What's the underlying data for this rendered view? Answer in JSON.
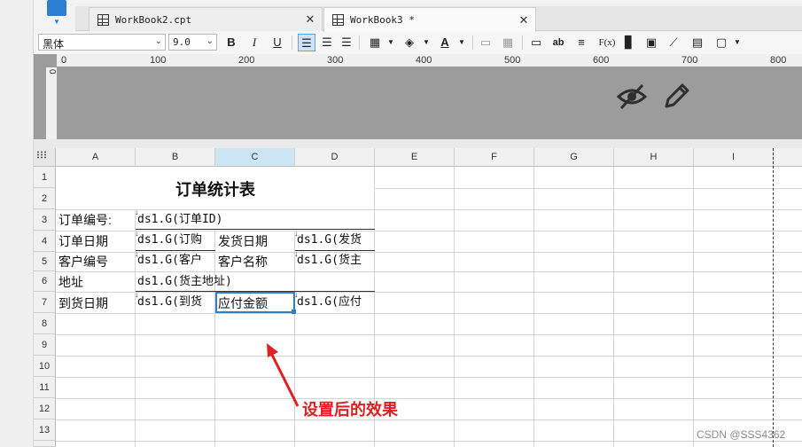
{
  "tabs": [
    {
      "label": "WorkBook2.cpt",
      "active": false
    },
    {
      "label": "WorkBook3 *",
      "active": true
    }
  ],
  "toolbar": {
    "font_name": "黑体",
    "font_size": "9.0",
    "bold": "B",
    "italic": "I",
    "underline": "U",
    "font_color_glyph": "A",
    "text_tool": "ab",
    "formula_tool": "F(x)"
  },
  "ruler": {
    "h_ticks": [
      "0",
      "100",
      "200",
      "300",
      "400",
      "500",
      "600",
      "700",
      "800"
    ],
    "v_label": "0"
  },
  "grid": {
    "columns": [
      "A",
      "B",
      "C",
      "D",
      "E",
      "F",
      "G",
      "H",
      "I"
    ],
    "rows": [
      "1",
      "2",
      "3",
      "4",
      "5",
      "6",
      "7",
      "8",
      "9",
      "10",
      "11",
      "12",
      "13"
    ],
    "selected_column": "C"
  },
  "report": {
    "title": "订单统计表",
    "order_id_label": "订单编号:",
    "order_id_value": "ds1.G(订单ID)",
    "order_date_label": "订单日期",
    "order_date_value": "ds1.G(订购",
    "ship_date_label": "发货日期",
    "ship_date_value": "ds1.G(发货",
    "customer_id_label": "客户编号",
    "customer_id_value": "ds1.G(客户",
    "customer_name_label": "客户名称",
    "customer_name_value": "ds1.G(货主",
    "address_label": "地址",
    "address_value": "ds1.G(货主地址)",
    "arrival_label": "到货日期",
    "arrival_value": "ds1.G(到货",
    "payable_label": "应付金额",
    "payable_value": "ds1.G(应付"
  },
  "annotation": "设置后的效果",
  "watermark": "CSDN @SSS4362",
  "colors": {
    "selection": "#2d7dd2",
    "annotation": "#e02020",
    "selected_column_header": "#cde6f5"
  }
}
